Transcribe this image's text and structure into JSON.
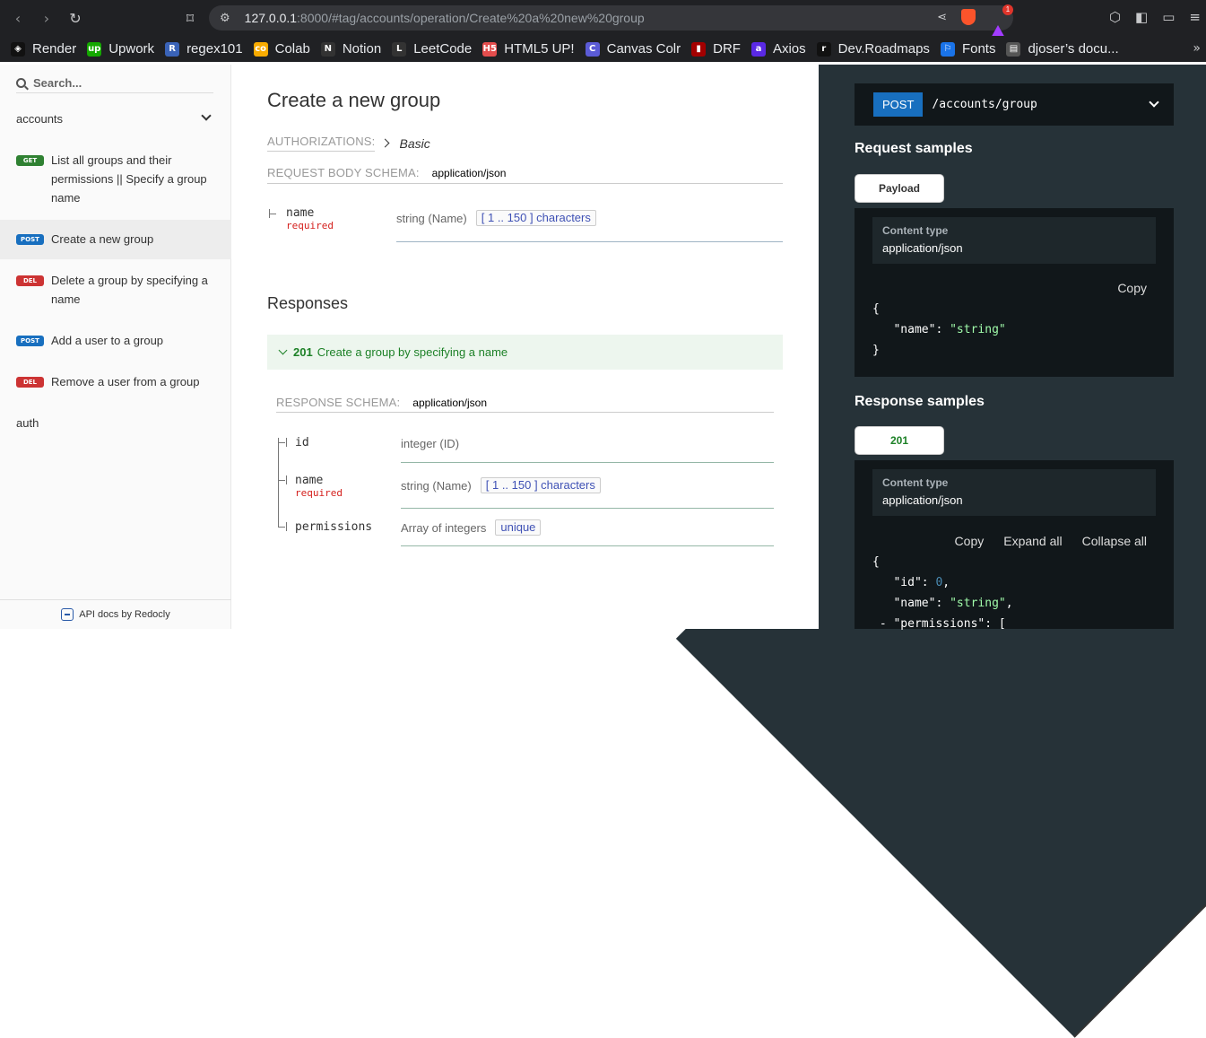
{
  "browser": {
    "url_host": "127.0.0.1",
    "url_rest": ":8000/#tag/accounts/operation/Create%20a%20new%20group",
    "rewards_badge": "1"
  },
  "bookmarks": [
    {
      "label": "Render",
      "color": "#111",
      "glyph": "◈"
    },
    {
      "label": "Upwork",
      "color": "#14a800",
      "glyph": "up"
    },
    {
      "label": "regex101",
      "color": "#3a63b8",
      "glyph": "R"
    },
    {
      "label": "Colab",
      "color": "#f9ab00",
      "glyph": "co"
    },
    {
      "label": "Notion",
      "color": "#333",
      "glyph": "N"
    },
    {
      "label": "LeetCode",
      "color": "#333",
      "glyph": "L"
    },
    {
      "label": "HTML5 UP!",
      "color": "#e44d4d",
      "glyph": "H5"
    },
    {
      "label": "Canvas Colr",
      "color": "#5b5bd6",
      "glyph": "C"
    },
    {
      "label": "DRF",
      "color": "#a30000",
      "glyph": "▮"
    },
    {
      "label": "Axios",
      "color": "#5a29e4",
      "glyph": "a"
    },
    {
      "label": "Dev.Roadmaps",
      "color": "#111",
      "glyph": "r"
    },
    {
      "label": "Fonts",
      "color": "#1a73e8",
      "glyph": "⚐"
    },
    {
      "label": "djoser’s docu...",
      "color": "#555",
      "glyph": "▤"
    }
  ],
  "sidebar": {
    "search_placeholder": "Search...",
    "groups": [
      {
        "label": "accounts"
      },
      {
        "label": "auth"
      }
    ],
    "items": [
      {
        "method": "GET",
        "label": "List all groups and their permissions || Specify a group name"
      },
      {
        "method": "POST",
        "label": "Create a new group"
      },
      {
        "method": "DEL",
        "label": "Delete a group by specifying a name"
      },
      {
        "method": "POST",
        "label": "Add a user to a group"
      },
      {
        "method": "DEL",
        "label": "Remove a user from a group"
      }
    ],
    "footer": "API docs by Redocly"
  },
  "main": {
    "title": "Create a new group",
    "auth_label": "AUTHORIZATIONS:",
    "auth_value": "Basic",
    "req_schema_label": "REQUEST BODY SCHEMA:",
    "req_schema_type": "application/json",
    "request_fields": [
      {
        "name": "name",
        "required": "required",
        "type": "string (Name)",
        "constraint": "[ 1 .. 150 ] characters"
      }
    ],
    "responses_title": "Responses",
    "response": {
      "code": "201",
      "description": "Create a group by specifying a name"
    },
    "resp_schema_label": "RESPONSE SCHEMA:",
    "resp_schema_type": "application/json",
    "response_fields": [
      {
        "name": "id",
        "required": "",
        "type": "integer (ID)",
        "constraint": ""
      },
      {
        "name": "name",
        "required": "required",
        "type": "string (Name)",
        "constraint": "[ 1 .. 150 ] characters"
      },
      {
        "name": "permissions",
        "required": "",
        "type": "Array of integers",
        "constraint": "unique"
      }
    ]
  },
  "right": {
    "method": "POST",
    "path": "/accounts/group",
    "request_samples": "Request samples",
    "payload_tab": "Payload",
    "content_type_label": "Content type",
    "content_type": "application/json",
    "copy": "Copy",
    "expand_all": "Expand all",
    "collapse_all": "Collapse all",
    "response_samples": "Response samples",
    "response_tab": "201"
  }
}
